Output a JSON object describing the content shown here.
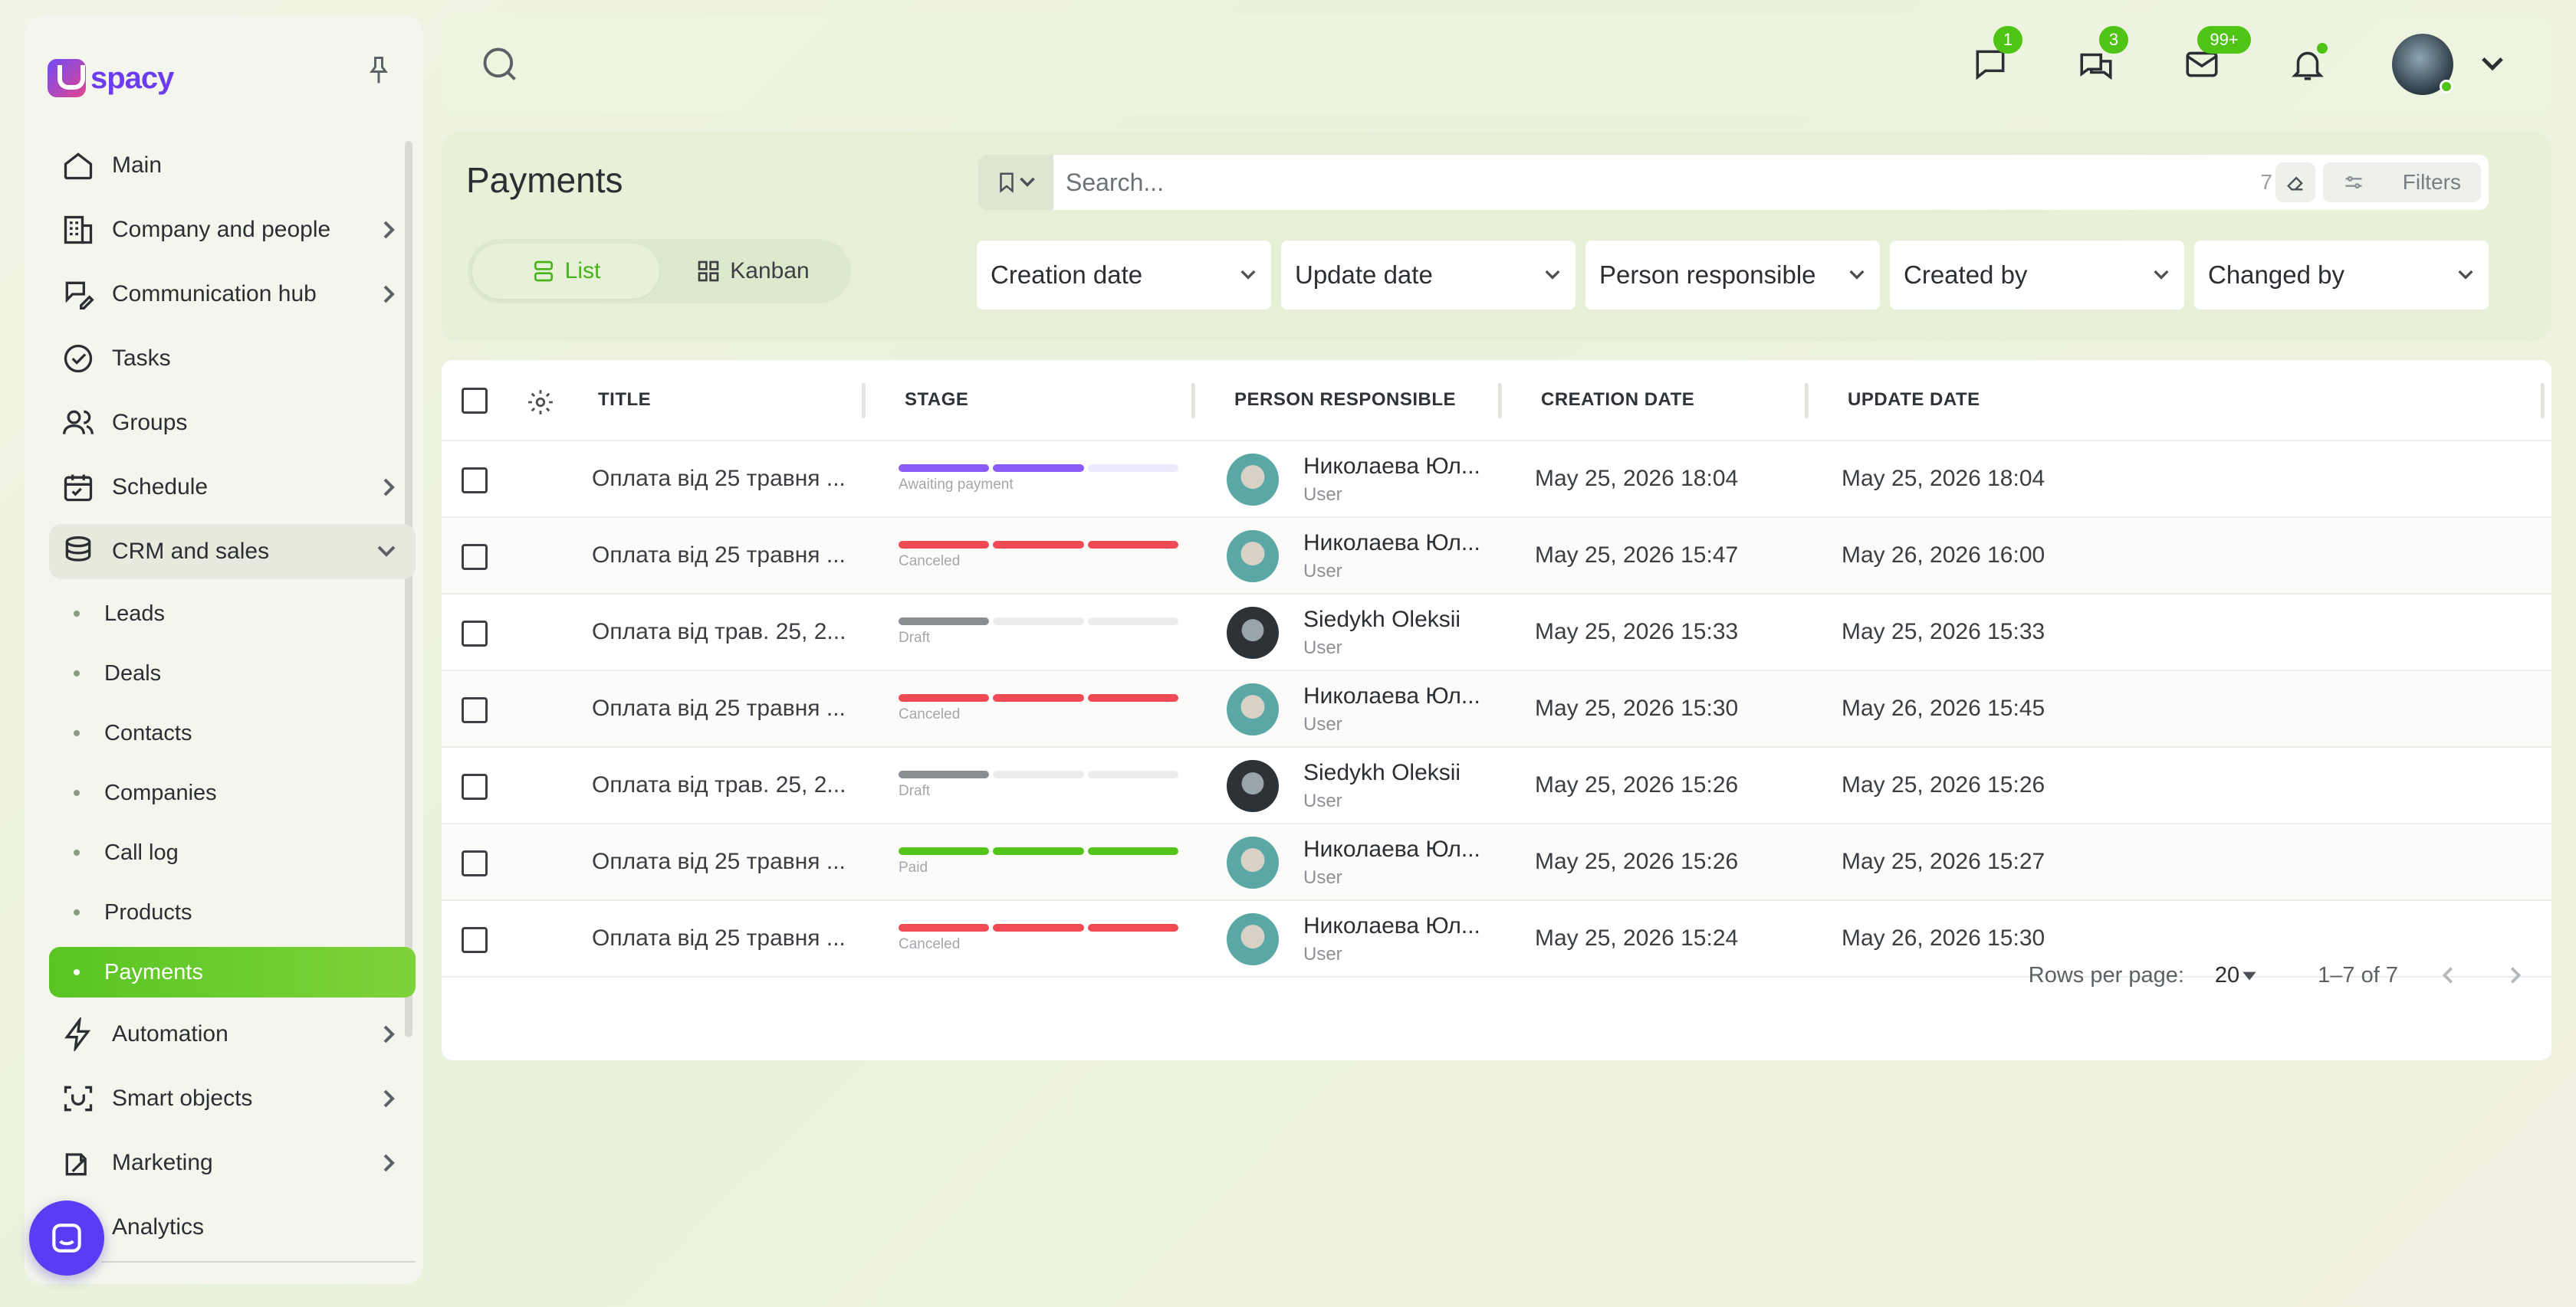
{
  "app": {
    "logo_text": "spacy"
  },
  "sidebar": {
    "items": [
      {
        "label": "Main",
        "icon": "home-icon",
        "has_arrow": false
      },
      {
        "label": "Company and people",
        "icon": "building-icon",
        "has_arrow": true
      },
      {
        "label": "Communication hub",
        "icon": "chat-edit-icon",
        "has_arrow": true
      },
      {
        "label": "Tasks",
        "icon": "check-circle-icon",
        "has_arrow": false
      },
      {
        "label": "Groups",
        "icon": "users-icon",
        "has_arrow": false
      },
      {
        "label": "Schedule",
        "icon": "calendar-icon",
        "has_arrow": true
      },
      {
        "label": "CRM and sales",
        "icon": "database-icon",
        "has_arrow": true,
        "expanded": true
      }
    ],
    "crm_subitems": [
      "Leads",
      "Deals",
      "Contacts",
      "Companies",
      "Call log",
      "Products",
      "Payments"
    ],
    "active_subitem": "Payments",
    "bottom_items": [
      {
        "label": "Automation",
        "icon": "lightning-icon"
      },
      {
        "label": "Smart objects",
        "icon": "scan-face-icon"
      },
      {
        "label": "Marketing",
        "icon": "megaphone-icon"
      },
      {
        "label": "Analytics",
        "icon": "chart-icon"
      }
    ]
  },
  "topbar": {
    "badges": {
      "chat": "1",
      "comments": "3",
      "mail": "99+"
    }
  },
  "header": {
    "title": "Payments",
    "views": {
      "list": "List",
      "kanban": "Kanban"
    },
    "search_placeholder": "Search...",
    "search_count": "7",
    "filters_label": "Filters",
    "filter_selects": [
      "Creation date",
      "Update date",
      "Person responsible",
      "Created by",
      "Changed by"
    ]
  },
  "table": {
    "columns": {
      "title": "TITLE",
      "stage": "STAGE",
      "person": "PERSON RESPONSIBLE",
      "created": "CREATION DATE",
      "updated": "UPDATE DATE"
    },
    "rows": [
      {
        "title": "Оплата від 25 травня ...",
        "stage": "Awaiting payment",
        "stage_color": "#8b5cf6",
        "filled": 2,
        "person": "Николаева Юл...",
        "role": "User",
        "avatar": "teal",
        "created": "May 25, 2026 18:04",
        "updated": "May 25, 2026 18:04"
      },
      {
        "title": "Оплата від 25 травня ...",
        "stage": "Canceled",
        "stage_color": "#f04b55",
        "filled": 3,
        "person": "Николаева Юл...",
        "role": "User",
        "avatar": "teal",
        "created": "May 25, 2026 15:47",
        "updated": "May 26, 2026 16:00"
      },
      {
        "title": "Оплата від трав. 25, 2...",
        "stage": "Draft",
        "stage_color": "#8a8d92",
        "filled": 1,
        "person": "Siedykh Oleksii",
        "role": "User",
        "avatar": "dark",
        "created": "May 25, 2026 15:33",
        "updated": "May 25, 2026 15:33"
      },
      {
        "title": "Оплата від 25 травня ...",
        "stage": "Canceled",
        "stage_color": "#f04b55",
        "filled": 3,
        "person": "Николаева Юл...",
        "role": "User",
        "avatar": "teal",
        "created": "May 25, 2026 15:30",
        "updated": "May 26, 2026 15:45"
      },
      {
        "title": "Оплата від трав. 25, 2...",
        "stage": "Draft",
        "stage_color": "#8a8d92",
        "filled": 1,
        "person": "Siedykh Oleksii",
        "role": "User",
        "avatar": "dark",
        "created": "May 25, 2026 15:26",
        "updated": "May 25, 2026 15:26"
      },
      {
        "title": "Оплата від 25 травня ...",
        "stage": "Paid",
        "stage_color": "#52c41a",
        "filled": 3,
        "person": "Николаева Юл...",
        "role": "User",
        "avatar": "teal",
        "created": "May 25, 2026 15:26",
        "updated": "May 25, 2026 15:27"
      },
      {
        "title": "Оплата від 25 травня ...",
        "stage": "Canceled",
        "stage_color": "#f04b55",
        "filled": 3,
        "person": "Николаева Юл...",
        "role": "User",
        "avatar": "teal",
        "created": "May 25, 2026 15:24",
        "updated": "May 26, 2026 15:30"
      }
    ]
  },
  "pagination": {
    "rows_per_page_label": "Rows per page:",
    "rows_per_page": "20",
    "range": "1–7 of 7"
  }
}
